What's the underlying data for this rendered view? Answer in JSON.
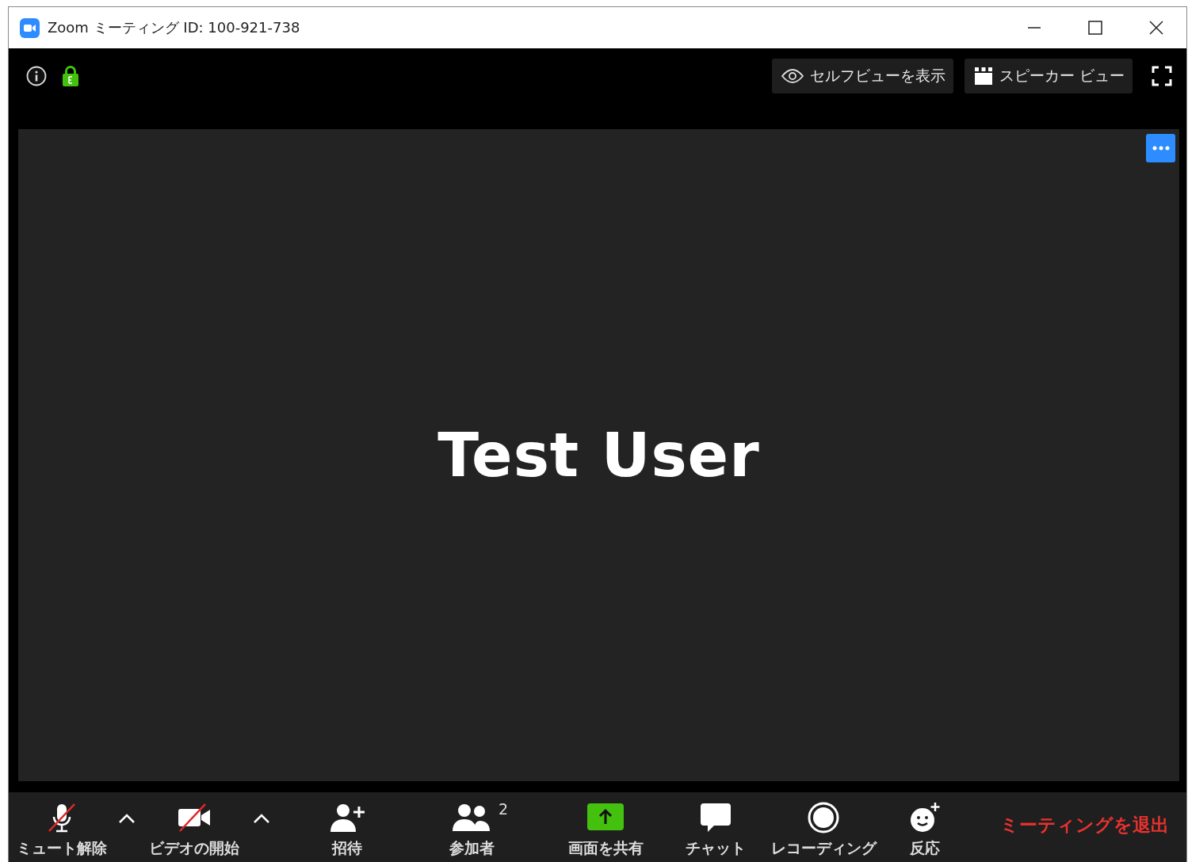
{
  "window": {
    "title": "Zoom ミーティング ID: 100-921-738"
  },
  "top_bar": {
    "buttons": [
      {
        "kind": "eye",
        "label": "セルフビューを表示"
      },
      {
        "kind": "grid",
        "label": "スピーカー ビュー"
      }
    ]
  },
  "video": {
    "participant_name": "Test User"
  },
  "toolbar": {
    "items": [
      {
        "kind": "mic",
        "label": "ミュート解除",
        "slashed": true,
        "menu": true
      },
      {
        "kind": "camera",
        "label": "ビデオの開始",
        "slashed": true,
        "menu": true
      },
      {
        "kind": "invite",
        "label": "招待",
        "slashed": false,
        "menu": false
      },
      {
        "kind": "participants",
        "label": "参加者",
        "count": "2",
        "slashed": false,
        "menu": false
      },
      {
        "kind": "share",
        "label": "画面を共有",
        "slashed": false,
        "menu": false
      },
      {
        "kind": "chat",
        "label": "チャット",
        "slashed": false,
        "menu": false
      },
      {
        "kind": "record",
        "label": "レコーディング",
        "slashed": false,
        "menu": false
      },
      {
        "kind": "reaction",
        "label": "反応",
        "slashed": false,
        "menu": false
      }
    ],
    "leave": "ミーティングを退出"
  }
}
